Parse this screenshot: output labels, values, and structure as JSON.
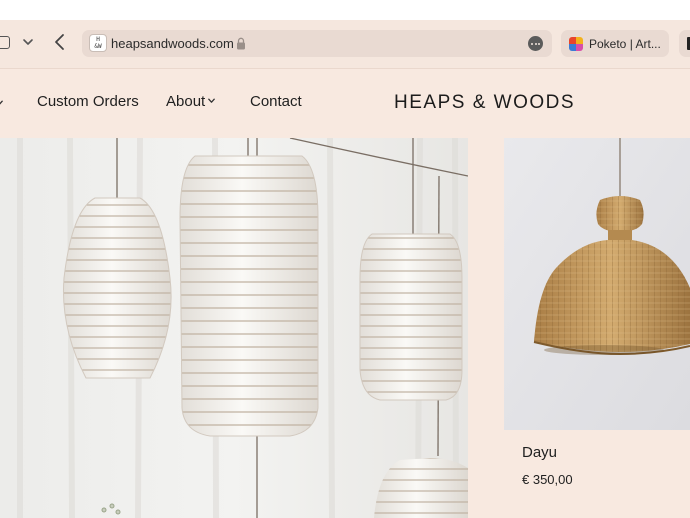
{
  "browser": {
    "address": "heapsandwoods.com",
    "favicon_text": "H\n&W",
    "tabs": [
      {
        "label": "Poketo | Art..."
      }
    ],
    "icons": {
      "sidebar": "sidebar-icon",
      "tabs_overview": "chevron-down-icon",
      "back": "chevron-left-icon",
      "security": "lock-icon",
      "page_menu": "more-icon"
    }
  },
  "header": {
    "nav": [
      {
        "label": "Custom Orders"
      },
      {
        "label": "About"
      },
      {
        "label": "Contact"
      }
    ],
    "brand": "HEAPS & WOODS"
  },
  "products": [
    {
      "name": "Dayu",
      "price": "€ 350,00"
    }
  ],
  "colors": {
    "page_background": "#f8e9e0",
    "toolbar_background": "#f5e7de",
    "address_bar": "#e9dad2",
    "text": "#1f1f1f",
    "rattan": "#c49a5c"
  }
}
